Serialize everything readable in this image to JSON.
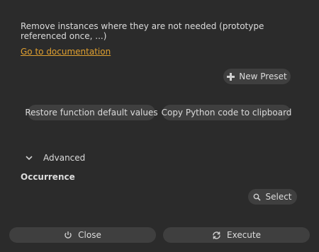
{
  "description": "Remove instances where they are not needed (prototype referenced once, ...)",
  "doc_link": "Go to documentation",
  "presets": {
    "new_preset_label": "New Preset"
  },
  "actions": {
    "restore_label": "Restore function default values",
    "copy_python_label": "Copy Python code to clipboard"
  },
  "advanced": {
    "label": "Advanced",
    "expanded": true
  },
  "occurrence": {
    "label": "Occurrence",
    "select_label": "Select"
  },
  "footer": {
    "close_label": "Close",
    "execute_label": "Execute"
  },
  "colors": {
    "background": "#2b2b2b",
    "button": "#3f3f3f",
    "link": "#e0a030",
    "text": "#dcdcdc"
  },
  "icons": {
    "new_preset": "plus-icon",
    "advanced": "chevron-down-icon",
    "select": "search-icon",
    "close": "power-icon",
    "execute": "refresh-icon"
  }
}
